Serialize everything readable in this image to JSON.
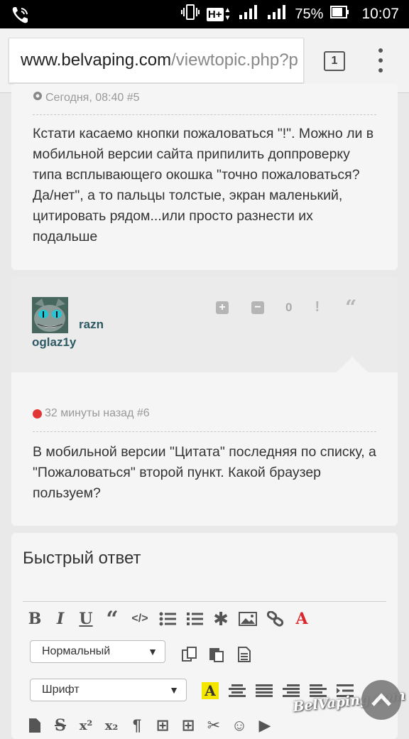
{
  "status_bar": {
    "network": "H+",
    "battery": "75%",
    "time": "10:07"
  },
  "browser": {
    "url_domain": "www.belvaping.com",
    "url_path": "/viewtopic.php?p",
    "tab_count": "1"
  },
  "post1": {
    "date": "Сегодня, 08:40 #5",
    "text": "Кстати касаемо кнопки пожаловаться \"!\". Можно ли в мобильной версии сайта припилить доппроверку типа всплывающего окошка \"точно пожаловаться? Да/нет\", а то пальцы толстые, экран маленький, цитировать рядом...или просто разнести их подальше"
  },
  "post2": {
    "author_line1": "razn",
    "author_line2": "oglaz1y",
    "score": "0",
    "date": "32 минуты назад #6",
    "text": "В мобильной версии \"Цитата\" последняя по списку, а \"Пожаловаться\" второй пункт. Какой браузер пользуем?"
  },
  "reply": {
    "title": "Быстрый ответ",
    "format_select": "Нормальный",
    "font_select": "Шрифт"
  },
  "watermark": "BelVaping.com",
  "colors": {
    "author": "#2c5964",
    "status_online": "#e23535",
    "font_color_icon": "#d9262d",
    "highlight_icon": "#f5e600"
  }
}
